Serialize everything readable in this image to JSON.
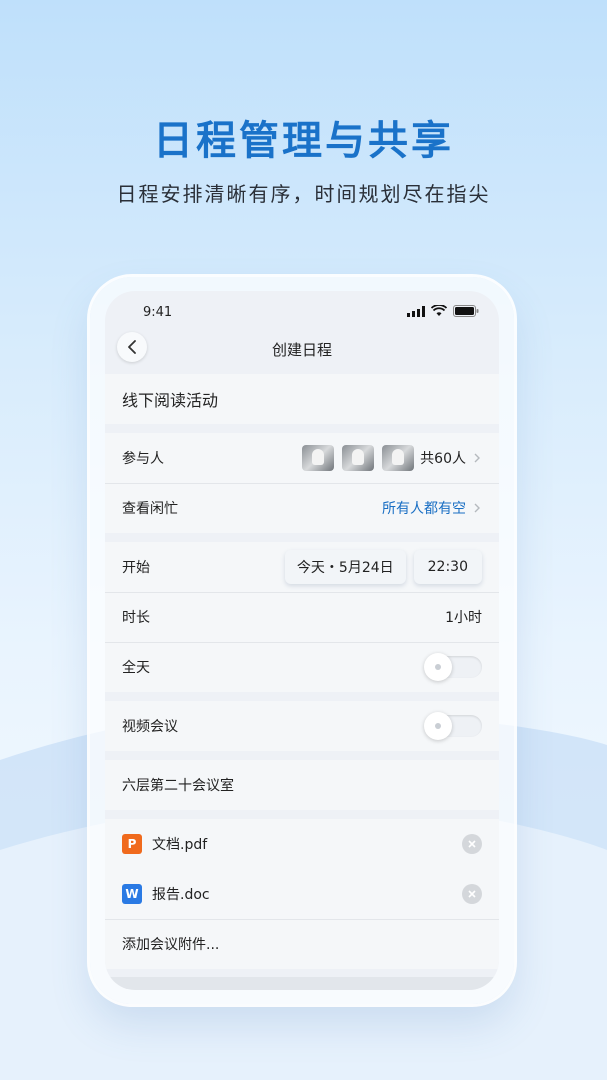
{
  "hero": {
    "title": "日程管理与共享",
    "subtitle": "日程安排清晰有序，时间规划尽在指尖"
  },
  "status_bar": {
    "time": "9:41",
    "icons": [
      "signal-icon",
      "wifi-icon",
      "battery-icon"
    ]
  },
  "nav": {
    "back_icon": "chevron-left-icon",
    "title": "创建日程"
  },
  "event": {
    "title": "线下阅读活动"
  },
  "participants": {
    "label": "参与人",
    "count": "共60人"
  },
  "availability": {
    "label": "查看闲忙",
    "value": "所有人都有空"
  },
  "schedule": {
    "start_label": "开始",
    "start_date": "今天・5月24日",
    "start_time": "22:30",
    "duration_label": "时长",
    "duration_value": "1小时",
    "all_day_label": "全天",
    "all_day_on": false
  },
  "video": {
    "label": "视频会议",
    "on": false
  },
  "location": {
    "value": "六层第二十会议室"
  },
  "attachments": {
    "files": [
      {
        "icon": "P",
        "icon_color": "#f06a1d",
        "name": "文档.pdf"
      },
      {
        "icon": "W",
        "icon_color": "#2a7ae4",
        "name": "报告.doc"
      }
    ],
    "add_label": "添加会议附件..."
  },
  "colors": {
    "accent": "#1a72c9",
    "link": "#1a6fc4"
  }
}
